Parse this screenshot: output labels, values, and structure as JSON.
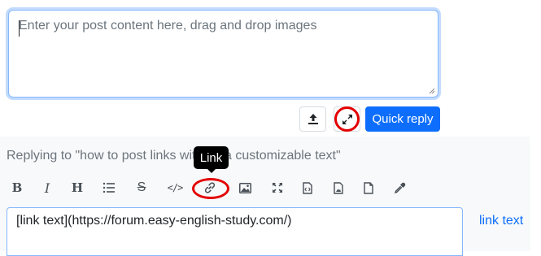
{
  "quick_reply": {
    "placeholder": "Enter your post content here, drag and drop images",
    "submit_label": "Quick reply"
  },
  "composer": {
    "replying_to": "Replying to \"how to post links without a customizable text\"",
    "tooltip": "Link",
    "toolbar": [
      {
        "name": "bold",
        "icon": "bold-icon",
        "label": "B"
      },
      {
        "name": "italic",
        "icon": "italic-icon",
        "label": "I"
      },
      {
        "name": "heading",
        "icon": "heading-icon",
        "label": "H"
      },
      {
        "name": "bullet-list",
        "icon": "list-icon"
      },
      {
        "name": "strikethrough",
        "icon": "strikethrough-icon",
        "label": "S"
      },
      {
        "name": "code",
        "icon": "code-icon",
        "label": "</>"
      },
      {
        "name": "link",
        "icon": "link-icon"
      },
      {
        "name": "image",
        "icon": "image-icon"
      },
      {
        "name": "expand",
        "icon": "expand-icon"
      },
      {
        "name": "code-file",
        "icon": "code-file-icon"
      },
      {
        "name": "image-file",
        "icon": "image-file-icon"
      },
      {
        "name": "file",
        "icon": "file-icon"
      },
      {
        "name": "color-picker",
        "icon": "eyedropper-icon"
      }
    ],
    "editor_value": "[link text](https://forum.easy-english-study.com/)",
    "preview_link": "link text"
  },
  "colors": {
    "accent": "#0d6efd",
    "highlight_circle": "#e30000",
    "muted_text": "#6c757d",
    "panel_bg": "#f8f9fa"
  }
}
